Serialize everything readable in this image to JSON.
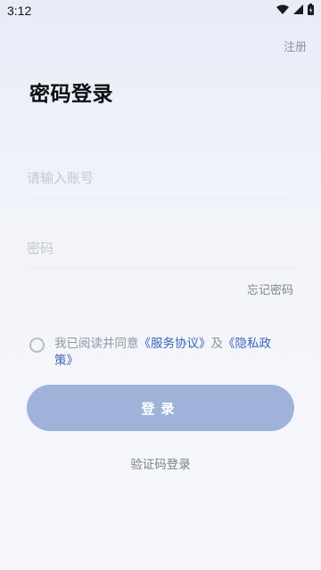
{
  "status_bar": {
    "time": "3:12",
    "icons": [
      "wifi-icon",
      "signal-icon",
      "battery-icon"
    ]
  },
  "header": {
    "register_label": "注册",
    "title": "密码登录"
  },
  "form": {
    "account_placeholder": "请输入账号",
    "password_placeholder": "密码",
    "forgot_label": "忘记密码"
  },
  "agreement": {
    "prefix": "我已阅读并同意",
    "service_link": "《服务协议》",
    "and": "及",
    "privacy_link": "《隐私政策》"
  },
  "actions": {
    "login_label": "登录",
    "code_login_label": "验证码登录"
  },
  "colors": {
    "button": "#9fb3da",
    "link": "#3d62b3"
  }
}
